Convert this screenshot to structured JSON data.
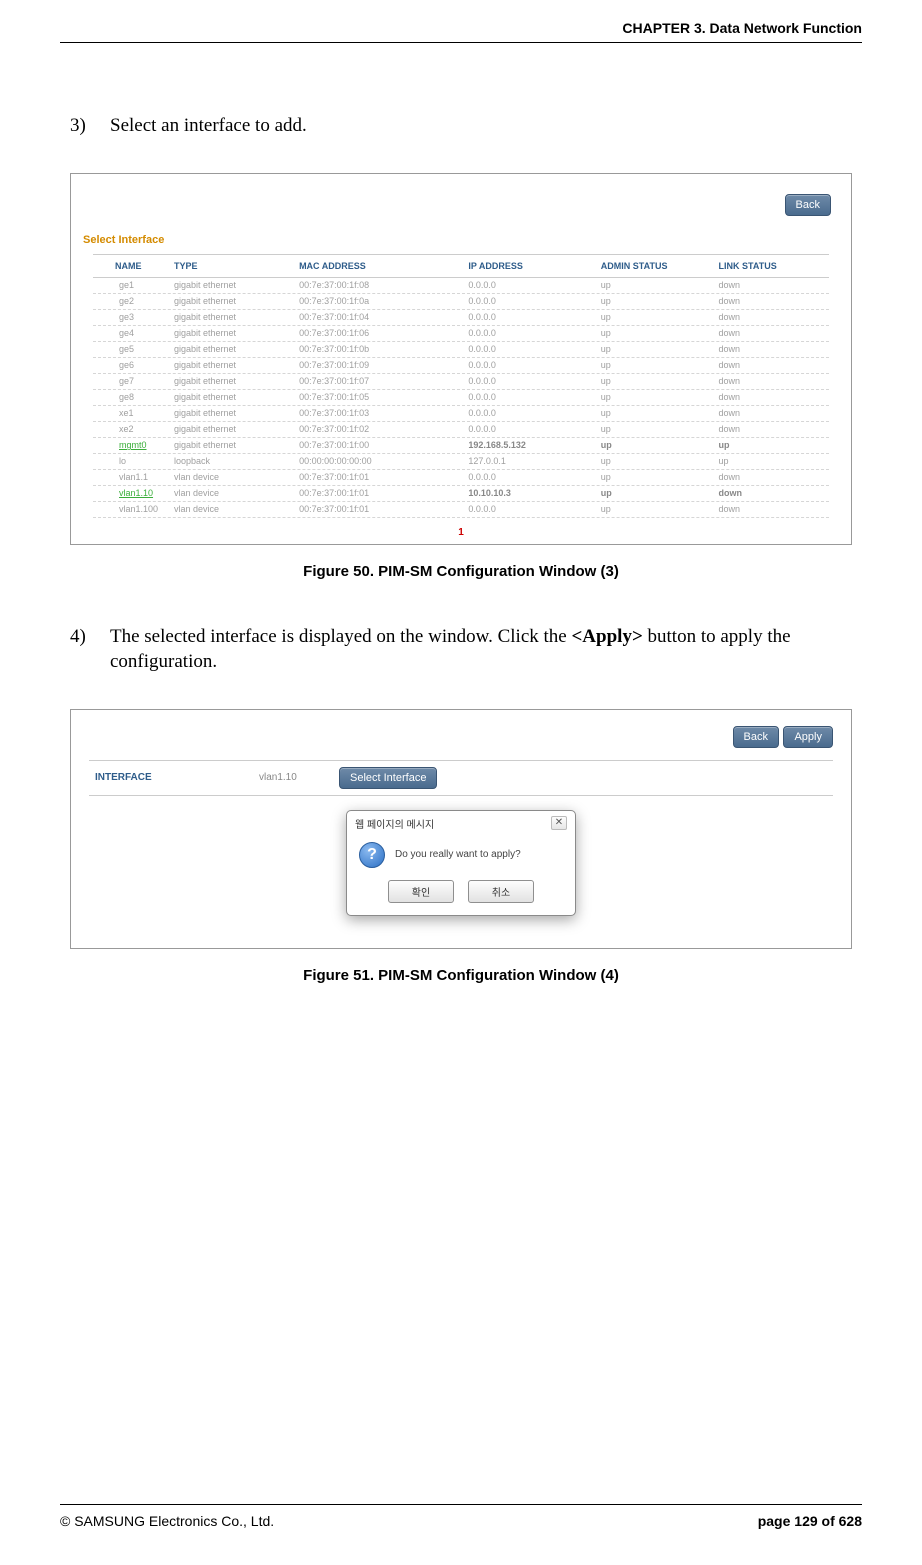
{
  "header": {
    "chapter": "CHAPTER 3. Data Network Function"
  },
  "steps": {
    "s3": {
      "num": "3)",
      "text": "Select an interface to add."
    },
    "s4": {
      "num": "4)",
      "text_a": "The selected interface is displayed on the window. Click the ",
      "bold": "<Apply>",
      "text_b": " button to apply the configuration."
    }
  },
  "fig1": {
    "back": "Back",
    "select_label": "Select Interface",
    "cols": {
      "name": "NAME",
      "type": "TYPE",
      "mac": "MAC ADDRESS",
      "ip": "IP ADDRESS",
      "admin": "ADMIN STATUS",
      "link": "LINK STATUS"
    },
    "rows": [
      {
        "name": "ge1",
        "type": "gigabit ethernet",
        "mac": "00:7e:37:00:1f:08",
        "ip": "0.0.0.0",
        "admin": "up",
        "link": "down"
      },
      {
        "name": "ge2",
        "type": "gigabit ethernet",
        "mac": "00:7e:37:00:1f:0a",
        "ip": "0.0.0.0",
        "admin": "up",
        "link": "down"
      },
      {
        "name": "ge3",
        "type": "gigabit ethernet",
        "mac": "00:7e:37:00:1f:04",
        "ip": "0.0.0.0",
        "admin": "up",
        "link": "down"
      },
      {
        "name": "ge4",
        "type": "gigabit ethernet",
        "mac": "00:7e:37:00:1f:06",
        "ip": "0.0.0.0",
        "admin": "up",
        "link": "down"
      },
      {
        "name": "ge5",
        "type": "gigabit ethernet",
        "mac": "00:7e:37:00:1f:0b",
        "ip": "0.0.0.0",
        "admin": "up",
        "link": "down"
      },
      {
        "name": "ge6",
        "type": "gigabit ethernet",
        "mac": "00:7e:37:00:1f:09",
        "ip": "0.0.0.0",
        "admin": "up",
        "link": "down"
      },
      {
        "name": "ge7",
        "type": "gigabit ethernet",
        "mac": "00:7e:37:00:1f:07",
        "ip": "0.0.0.0",
        "admin": "up",
        "link": "down"
      },
      {
        "name": "ge8",
        "type": "gigabit ethernet",
        "mac": "00:7e:37:00:1f:05",
        "ip": "0.0.0.0",
        "admin": "up",
        "link": "down"
      },
      {
        "name": "xe1",
        "type": "gigabit ethernet",
        "mac": "00:7e:37:00:1f:03",
        "ip": "0.0.0.0",
        "admin": "up",
        "link": "down"
      },
      {
        "name": "xe2",
        "type": "gigabit ethernet",
        "mac": "00:7e:37:00:1f:02",
        "ip": "0.0.0.0",
        "admin": "up",
        "link": "down"
      },
      {
        "name": "mgmt0",
        "type": "gigabit ethernet",
        "mac": "00:7e:37:00:1f:00",
        "ip": "192.168.5.132",
        "admin": "up",
        "link": "up",
        "hl": true
      },
      {
        "name": "lo",
        "type": "loopback",
        "mac": "00:00:00:00:00:00",
        "ip": "127.0.0.1",
        "admin": "up",
        "link": "up"
      },
      {
        "name": "vlan1.1",
        "type": "vlan device",
        "mac": "00:7e:37:00:1f:01",
        "ip": "0.0.0.0",
        "admin": "up",
        "link": "down"
      },
      {
        "name": "vlan1.10",
        "type": "vlan device",
        "mac": "00:7e:37:00:1f:01",
        "ip": "10.10.10.3",
        "admin": "up",
        "link": "down",
        "hl": true
      },
      {
        "name": "vlan1.100",
        "type": "vlan device",
        "mac": "00:7e:37:00:1f:01",
        "ip": "0.0.0.0",
        "admin": "up",
        "link": "down"
      }
    ],
    "page_indicator": "1",
    "caption": "Figure 50. PIM-SM Configuration Window (3)"
  },
  "fig2": {
    "back": "Back",
    "apply": "Apply",
    "iface_label": "INTERFACE",
    "iface_value": "vlan1.10",
    "select_btn": "Select Interface",
    "dialog": {
      "title": "웹 페이지의 메시지",
      "msg": "Do you really want to apply?",
      "ok": "확인",
      "cancel": "취소"
    },
    "caption": "Figure 51. PIM-SM Configuration Window (4)"
  },
  "footer": {
    "copyright": "© SAMSUNG Electronics Co., Ltd.",
    "page": "page 129 of 628"
  }
}
